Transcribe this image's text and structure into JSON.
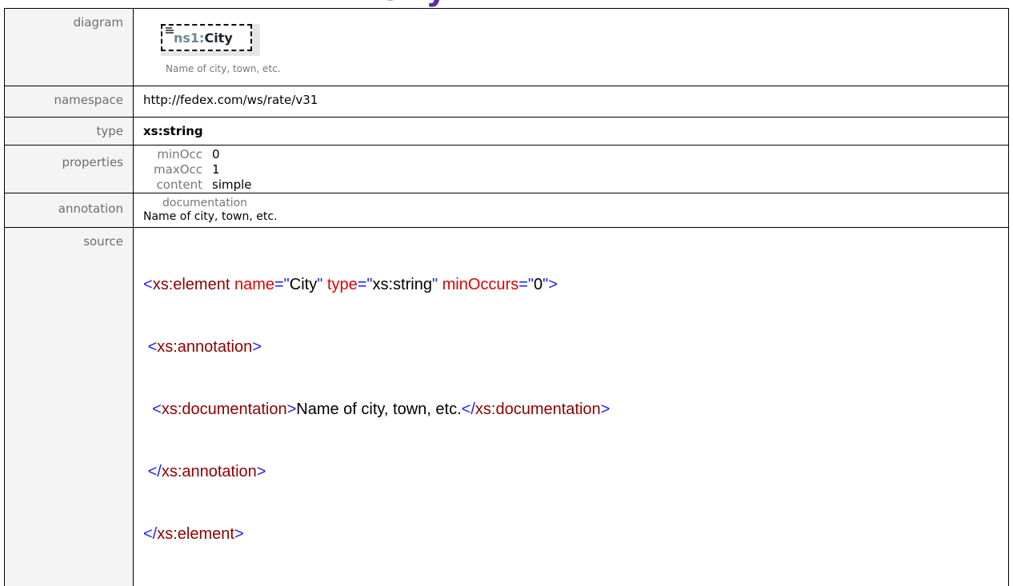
{
  "rows": {
    "diagram": {
      "label": "diagram",
      "element_prefix": "ns1:",
      "element_name": "City",
      "caption": "Name of city, town, etc."
    },
    "namespace": {
      "label": "namespace",
      "value": "http://fedex.com/ws/rate/v31"
    },
    "type": {
      "label": "type",
      "value": "xs:string"
    },
    "properties": {
      "label": "properties",
      "items": [
        {
          "key": "minOcc",
          "value": "0"
        },
        {
          "key": "maxOcc",
          "value": "1"
        },
        {
          "key": "content",
          "value": "simple"
        }
      ]
    },
    "annotation": {
      "label": "annotation",
      "doc_label": "documentation",
      "doc_text": "Name of city, town, etc."
    },
    "source": {
      "label": "source",
      "lines": [
        "<xs:element name=\"City\" type=\"xs:string\" minOccurs=\"0\">",
        " <xs:annotation>",
        "  <xs:documentation>Name of city, town, etc.</xs:documentation>",
        " </xs:annotation>",
        "</xs:element>"
      ]
    }
  },
  "colors": {
    "bracket": "#1a1aff",
    "tag": "#8b0000",
    "attr_name": "#e00000",
    "key_bg": "#f4f4f4"
  }
}
